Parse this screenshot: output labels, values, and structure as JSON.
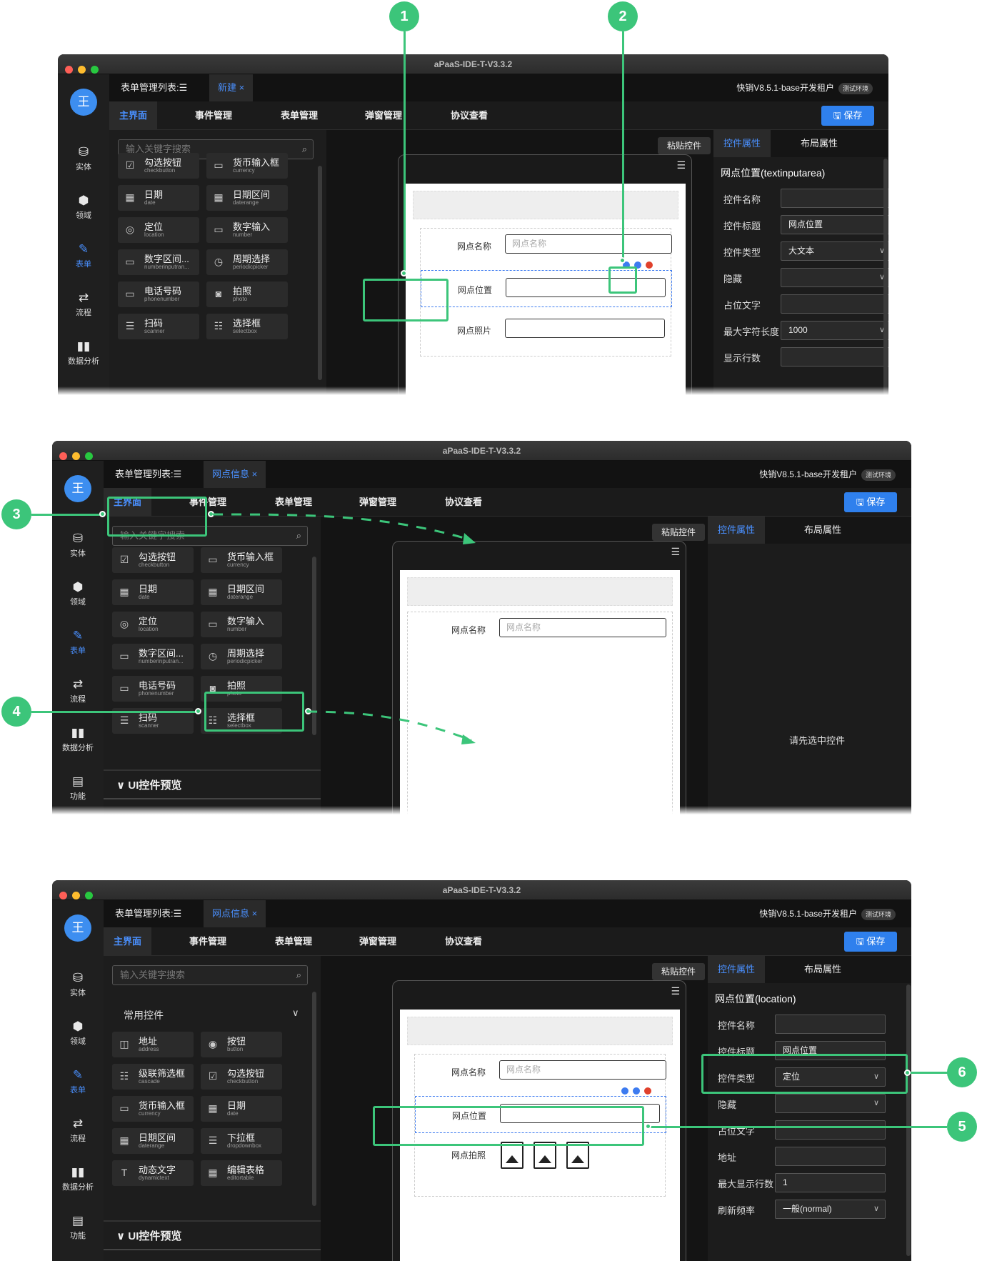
{
  "app": {
    "window_title": "aPaaS-IDE-T-V3.3.2",
    "avatar_text": "王",
    "tenant": "快销V8.5.1-base开发租户",
    "env_badge": "测试环境",
    "save_label": "保存",
    "paste_label": "粘贴控件",
    "sidebar": [
      {
        "icon": "database-icon",
        "label": "实体"
      },
      {
        "icon": "cube-icon",
        "label": "领域"
      },
      {
        "icon": "form-icon",
        "label": "表单"
      },
      {
        "icon": "flow-icon",
        "label": "流程"
      },
      {
        "icon": "chart-icon",
        "label": "数据分析"
      },
      {
        "icon": "function-icon",
        "label": "功能"
      }
    ],
    "menu": [
      "主界面",
      "事件管理",
      "表单管理",
      "弹窗管理",
      "协议查看"
    ],
    "right_tabs": [
      "控件属性",
      "布局属性"
    ],
    "list_tab": "表单管理列表:☰"
  },
  "panel1": {
    "doc_tab": "新建",
    "search_placeholder": "输入关键字搜索",
    "components": [
      {
        "name": "勾选按钮",
        "en": "checkbutton",
        "icon": "☑"
      },
      {
        "name": "货币输入框",
        "en": "currency",
        "icon": "▭"
      },
      {
        "name": "日期",
        "en": "date",
        "icon": "▦"
      },
      {
        "name": "日期区间",
        "en": "daterange",
        "icon": "▦"
      },
      {
        "name": "定位",
        "en": "location",
        "icon": "◎"
      },
      {
        "name": "数字输入",
        "en": "number",
        "icon": "▭"
      },
      {
        "name": "数字区间...",
        "en": "numberinputran...",
        "icon": "▭"
      },
      {
        "name": "周期选择",
        "en": "periodicpicker",
        "icon": "◷"
      },
      {
        "name": "电话号码",
        "en": "phonenumber",
        "icon": "▭"
      },
      {
        "name": "拍照",
        "en": "photo",
        "icon": "◙"
      },
      {
        "name": "扫码",
        "en": "scanner",
        "icon": "☰"
      },
      {
        "name": "选择框",
        "en": "selectbox",
        "icon": "☷"
      }
    ],
    "form": [
      {
        "label": "网点名称",
        "placeholder": "网点名称"
      },
      {
        "label": "网点位置",
        "placeholder": ""
      },
      {
        "label": "网点照片",
        "placeholder": ""
      }
    ],
    "prop_title": "网点位置(textinputarea)",
    "props": [
      {
        "label": "控件名称",
        "value": "",
        "select": false
      },
      {
        "label": "控件标题",
        "value": "网点位置",
        "select": false
      },
      {
        "label": "控件类型",
        "value": "大文本",
        "select": true
      },
      {
        "label": "隐藏",
        "value": "",
        "select": true
      },
      {
        "label": "占位文字",
        "value": "",
        "select": false
      },
      {
        "label": "最大字符长度",
        "value": "1000",
        "select": true
      },
      {
        "label": "显示行数",
        "value": "",
        "select": false
      }
    ]
  },
  "panel2": {
    "doc_tab": "网点信息",
    "search_placeholder": "输入关键字搜索",
    "components": [
      {
        "name": "勾选按钮",
        "en": "checkbutton",
        "icon": "☑"
      },
      {
        "name": "货币输入框",
        "en": "currency",
        "icon": "▭"
      },
      {
        "name": "日期",
        "en": "date",
        "icon": "▦"
      },
      {
        "name": "日期区间",
        "en": "daterange",
        "icon": "▦"
      },
      {
        "name": "定位",
        "en": "location",
        "icon": "◎"
      },
      {
        "name": "数字输入",
        "en": "number",
        "icon": "▭"
      },
      {
        "name": "数字区间...",
        "en": "numberinputran...",
        "icon": "▭"
      },
      {
        "name": "周期选择",
        "en": "periodicpicker",
        "icon": "◷"
      },
      {
        "name": "电话号码",
        "en": "phonenumber",
        "icon": "▭"
      },
      {
        "name": "拍照",
        "en": "photo",
        "icon": "◙"
      },
      {
        "name": "扫码",
        "en": "scanner",
        "icon": "☰"
      },
      {
        "name": "选择框",
        "en": "selectbox",
        "icon": "☷"
      }
    ],
    "ui_preview": "UI控件预览",
    "form_label": "网点名称",
    "form_placeholder": "网点名称",
    "empty_hint": "请先选中控件"
  },
  "panel3": {
    "doc_tab": "网点信息",
    "search_placeholder": "输入关键字搜索",
    "group_title": "常用控件",
    "components": [
      {
        "name": "地址",
        "en": "address",
        "icon": "◫"
      },
      {
        "name": "按钮",
        "en": "button",
        "icon": "◉"
      },
      {
        "name": "级联筛选框",
        "en": "cascade",
        "icon": "☷"
      },
      {
        "name": "勾选按钮",
        "en": "checkbutton",
        "icon": "☑"
      },
      {
        "name": "货币输入框",
        "en": "currency",
        "icon": "▭"
      },
      {
        "name": "日期",
        "en": "date",
        "icon": "▦"
      },
      {
        "name": "日期区间",
        "en": "daterange",
        "icon": "▦"
      },
      {
        "name": "下拉框",
        "en": "dropdownbox",
        "icon": "☰"
      },
      {
        "name": "动态文字",
        "en": "dynamictext",
        "icon": "T"
      },
      {
        "name": "编辑表格",
        "en": "editortable",
        "icon": "▦"
      }
    ],
    "ui_preview": "UI控件预览",
    "form": [
      {
        "label": "网点名称",
        "placeholder": "网点名称"
      },
      {
        "label": "网点位置",
        "placeholder": ""
      },
      {
        "label": "网点拍照",
        "placeholder": ""
      }
    ],
    "prop_title": "网点位置(location)",
    "props": [
      {
        "label": "控件名称",
        "value": "",
        "select": false
      },
      {
        "label": "控件标题",
        "value": "网点位置",
        "select": false
      },
      {
        "label": "控件类型",
        "value": "定位",
        "select": true
      },
      {
        "label": "隐藏",
        "value": "",
        "select": true
      },
      {
        "label": "占位文字",
        "value": "",
        "select": false
      },
      {
        "label": "地址",
        "value": "",
        "select": false
      },
      {
        "label": "最大显示行数",
        "value": "1",
        "select": false
      },
      {
        "label": "刷新频率",
        "value": "一般(normal)",
        "select": true
      }
    ]
  },
  "callouts": [
    "1",
    "2",
    "3",
    "4",
    "5",
    "6"
  ],
  "colors": {
    "accent": "#4a90ff",
    "highlight": "#3cc57a",
    "save": "#2f80ed"
  }
}
